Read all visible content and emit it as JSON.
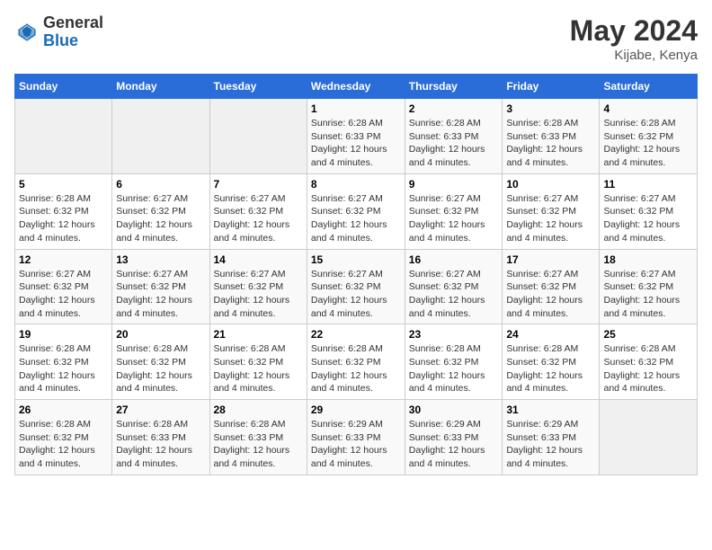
{
  "logo": {
    "general": "General",
    "blue": "Blue"
  },
  "header": {
    "month_year": "May 2024",
    "location": "Kijabe, Kenya"
  },
  "days_of_week": [
    "Sunday",
    "Monday",
    "Tuesday",
    "Wednesday",
    "Thursday",
    "Friday",
    "Saturday"
  ],
  "weeks": [
    [
      {
        "day": "",
        "info": ""
      },
      {
        "day": "",
        "info": ""
      },
      {
        "day": "",
        "info": ""
      },
      {
        "day": "1",
        "info": "Sunrise: 6:28 AM\nSunset: 6:33 PM\nDaylight: 12 hours and 4 minutes."
      },
      {
        "day": "2",
        "info": "Sunrise: 6:28 AM\nSunset: 6:33 PM\nDaylight: 12 hours and 4 minutes."
      },
      {
        "day": "3",
        "info": "Sunrise: 6:28 AM\nSunset: 6:33 PM\nDaylight: 12 hours and 4 minutes."
      },
      {
        "day": "4",
        "info": "Sunrise: 6:28 AM\nSunset: 6:32 PM\nDaylight: 12 hours and 4 minutes."
      }
    ],
    [
      {
        "day": "5",
        "info": "Sunrise: 6:28 AM\nSunset: 6:32 PM\nDaylight: 12 hours and 4 minutes."
      },
      {
        "day": "6",
        "info": "Sunrise: 6:27 AM\nSunset: 6:32 PM\nDaylight: 12 hours and 4 minutes."
      },
      {
        "day": "7",
        "info": "Sunrise: 6:27 AM\nSunset: 6:32 PM\nDaylight: 12 hours and 4 minutes."
      },
      {
        "day": "8",
        "info": "Sunrise: 6:27 AM\nSunset: 6:32 PM\nDaylight: 12 hours and 4 minutes."
      },
      {
        "day": "9",
        "info": "Sunrise: 6:27 AM\nSunset: 6:32 PM\nDaylight: 12 hours and 4 minutes."
      },
      {
        "day": "10",
        "info": "Sunrise: 6:27 AM\nSunset: 6:32 PM\nDaylight: 12 hours and 4 minutes."
      },
      {
        "day": "11",
        "info": "Sunrise: 6:27 AM\nSunset: 6:32 PM\nDaylight: 12 hours and 4 minutes."
      }
    ],
    [
      {
        "day": "12",
        "info": "Sunrise: 6:27 AM\nSunset: 6:32 PM\nDaylight: 12 hours and 4 minutes."
      },
      {
        "day": "13",
        "info": "Sunrise: 6:27 AM\nSunset: 6:32 PM\nDaylight: 12 hours and 4 minutes."
      },
      {
        "day": "14",
        "info": "Sunrise: 6:27 AM\nSunset: 6:32 PM\nDaylight: 12 hours and 4 minutes."
      },
      {
        "day": "15",
        "info": "Sunrise: 6:27 AM\nSunset: 6:32 PM\nDaylight: 12 hours and 4 minutes."
      },
      {
        "day": "16",
        "info": "Sunrise: 6:27 AM\nSunset: 6:32 PM\nDaylight: 12 hours and 4 minutes."
      },
      {
        "day": "17",
        "info": "Sunrise: 6:27 AM\nSunset: 6:32 PM\nDaylight: 12 hours and 4 minutes."
      },
      {
        "day": "18",
        "info": "Sunrise: 6:27 AM\nSunset: 6:32 PM\nDaylight: 12 hours and 4 minutes."
      }
    ],
    [
      {
        "day": "19",
        "info": "Sunrise: 6:28 AM\nSunset: 6:32 PM\nDaylight: 12 hours and 4 minutes."
      },
      {
        "day": "20",
        "info": "Sunrise: 6:28 AM\nSunset: 6:32 PM\nDaylight: 12 hours and 4 minutes."
      },
      {
        "day": "21",
        "info": "Sunrise: 6:28 AM\nSunset: 6:32 PM\nDaylight: 12 hours and 4 minutes."
      },
      {
        "day": "22",
        "info": "Sunrise: 6:28 AM\nSunset: 6:32 PM\nDaylight: 12 hours and 4 minutes."
      },
      {
        "day": "23",
        "info": "Sunrise: 6:28 AM\nSunset: 6:32 PM\nDaylight: 12 hours and 4 minutes."
      },
      {
        "day": "24",
        "info": "Sunrise: 6:28 AM\nSunset: 6:32 PM\nDaylight: 12 hours and 4 minutes."
      },
      {
        "day": "25",
        "info": "Sunrise: 6:28 AM\nSunset: 6:32 PM\nDaylight: 12 hours and 4 minutes."
      }
    ],
    [
      {
        "day": "26",
        "info": "Sunrise: 6:28 AM\nSunset: 6:32 PM\nDaylight: 12 hours and 4 minutes."
      },
      {
        "day": "27",
        "info": "Sunrise: 6:28 AM\nSunset: 6:33 PM\nDaylight: 12 hours and 4 minutes."
      },
      {
        "day": "28",
        "info": "Sunrise: 6:28 AM\nSunset: 6:33 PM\nDaylight: 12 hours and 4 minutes."
      },
      {
        "day": "29",
        "info": "Sunrise: 6:29 AM\nSunset: 6:33 PM\nDaylight: 12 hours and 4 minutes."
      },
      {
        "day": "30",
        "info": "Sunrise: 6:29 AM\nSunset: 6:33 PM\nDaylight: 12 hours and 4 minutes."
      },
      {
        "day": "31",
        "info": "Sunrise: 6:29 AM\nSunset: 6:33 PM\nDaylight: 12 hours and 4 minutes."
      },
      {
        "day": "",
        "info": ""
      }
    ]
  ]
}
